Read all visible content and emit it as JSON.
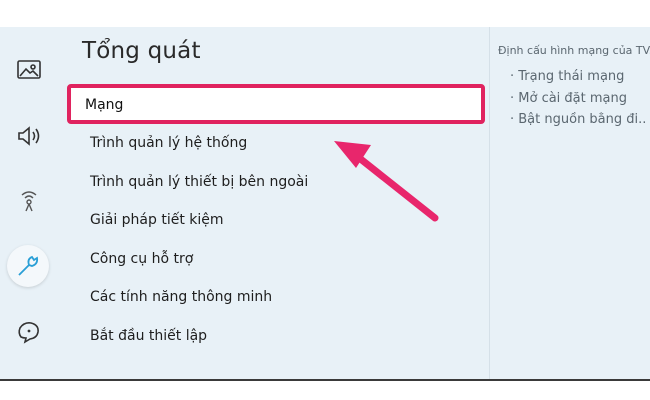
{
  "general": {
    "title": "Tổng quát",
    "selected_item": "Mạng",
    "items": [
      "Trình quản lý hệ thống",
      "Trình quản lý thiết bị bên ngoài",
      "Giải pháp tiết kiệm",
      "Công cụ hỗ trợ",
      "Các tính năng thông minh",
      "Bắt đầu thiết lập"
    ]
  },
  "description": {
    "title": "Định cấu hình mạng của TV.",
    "items": [
      "· Trạng thái mạng",
      "· Mở cài đặt mạng",
      "· Bật nguồn bằng đi..."
    ]
  },
  "sidebar": {
    "icons": [
      "picture-icon",
      "sound-icon",
      "broadcast-icon",
      "wrench-icon",
      "support-icon"
    ]
  },
  "colors": {
    "highlight": "#e0235f",
    "screen_bg": "#e8f1f7",
    "arrow": "#e8266c"
  }
}
